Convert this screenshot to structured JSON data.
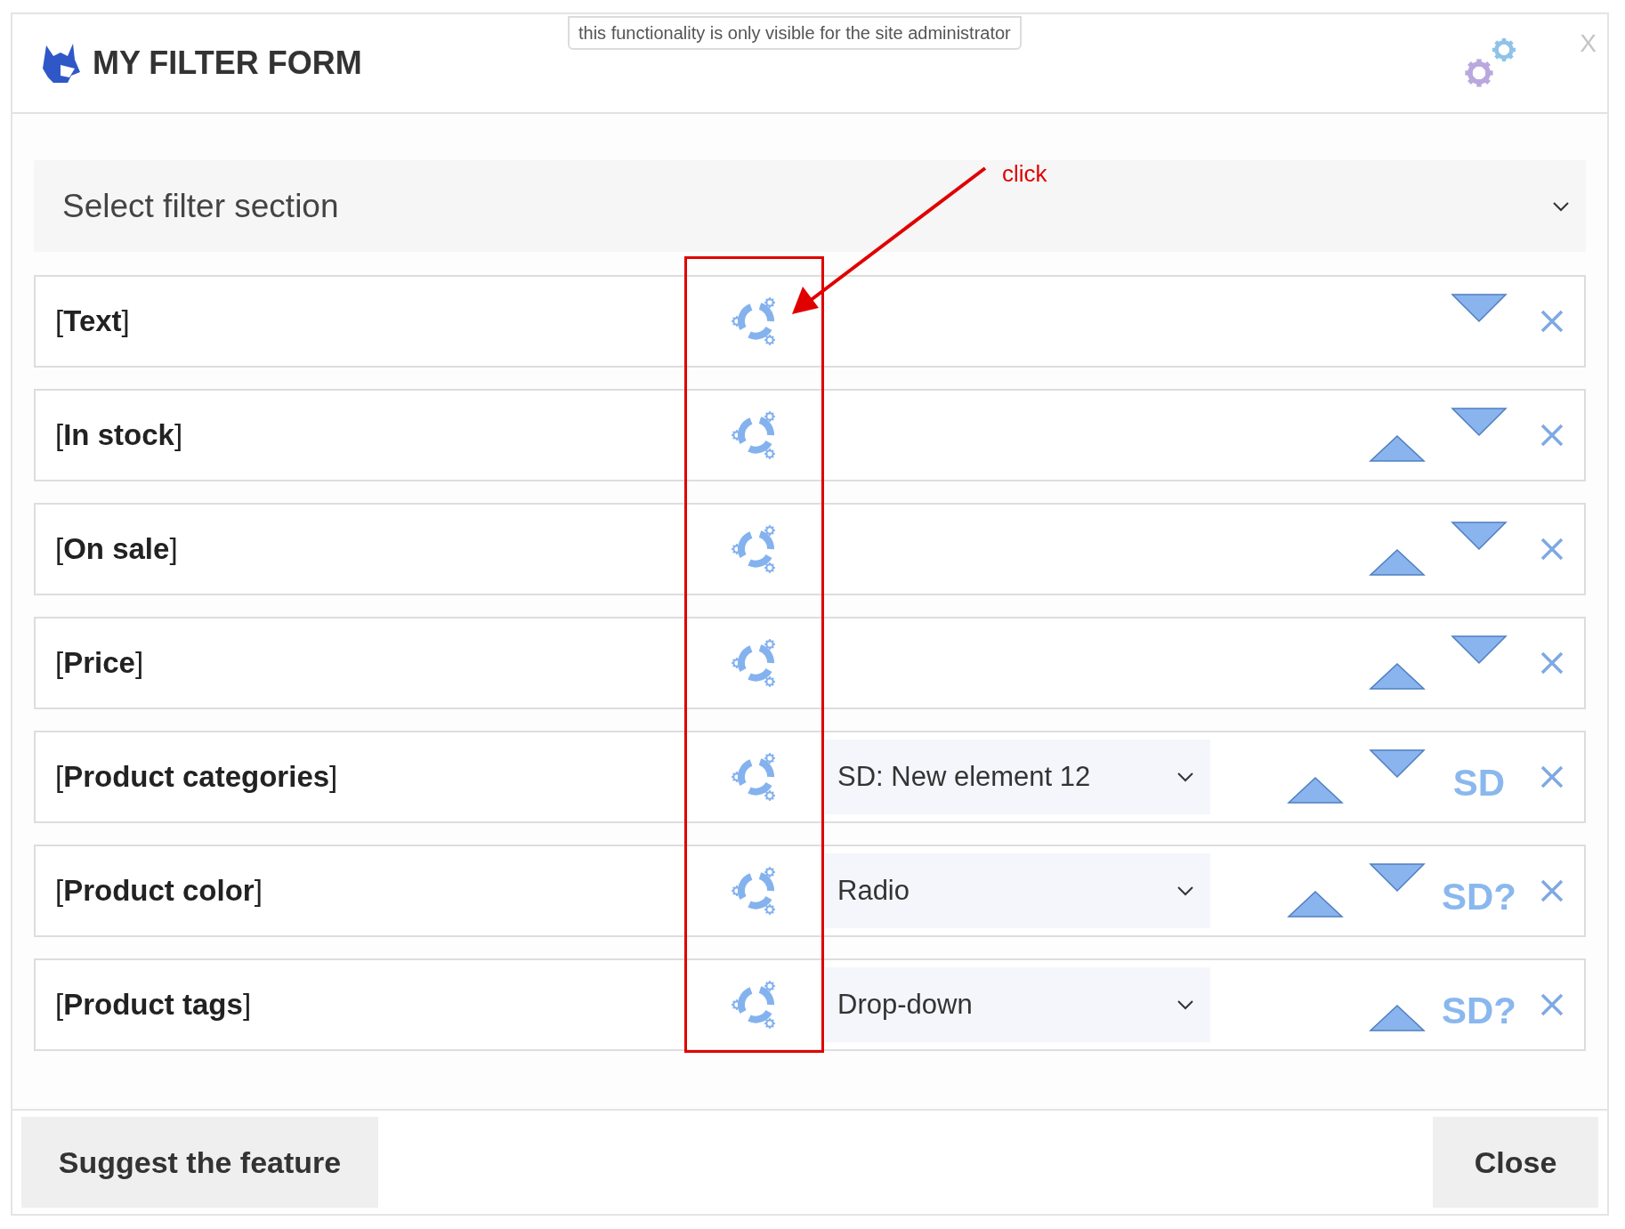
{
  "header": {
    "title": "MY FILTER FORM",
    "admin_note": "this functionality is only visible for the site administrator",
    "close": "X"
  },
  "section_select": {
    "value": "Select filter section"
  },
  "rows": [
    {
      "label": "[**Text**]",
      "select": null,
      "move_up": false,
      "move_down": true,
      "sd": null
    },
    {
      "label": "[**In stock**]",
      "select": null,
      "move_up": true,
      "move_down": true,
      "sd": null
    },
    {
      "label": "[**On sale**]",
      "select": null,
      "move_up": true,
      "move_down": true,
      "sd": null
    },
    {
      "label": "[**Price**]",
      "select": null,
      "move_up": true,
      "move_down": true,
      "sd": null
    },
    {
      "label": "[**Product categories**]",
      "select": "SD: New element 12",
      "move_up": true,
      "move_down": true,
      "sd": "SD"
    },
    {
      "label": "[**Product color**]",
      "select": "Radio",
      "move_up": true,
      "move_down": true,
      "sd": "SD?"
    },
    {
      "label": "[**Product tags**]",
      "select": "Drop-down",
      "move_up": true,
      "move_down": false,
      "sd": "SD?"
    }
  ],
  "footer": {
    "suggest": "Suggest the feature",
    "close": "Close"
  },
  "annotation": {
    "label": "click"
  }
}
